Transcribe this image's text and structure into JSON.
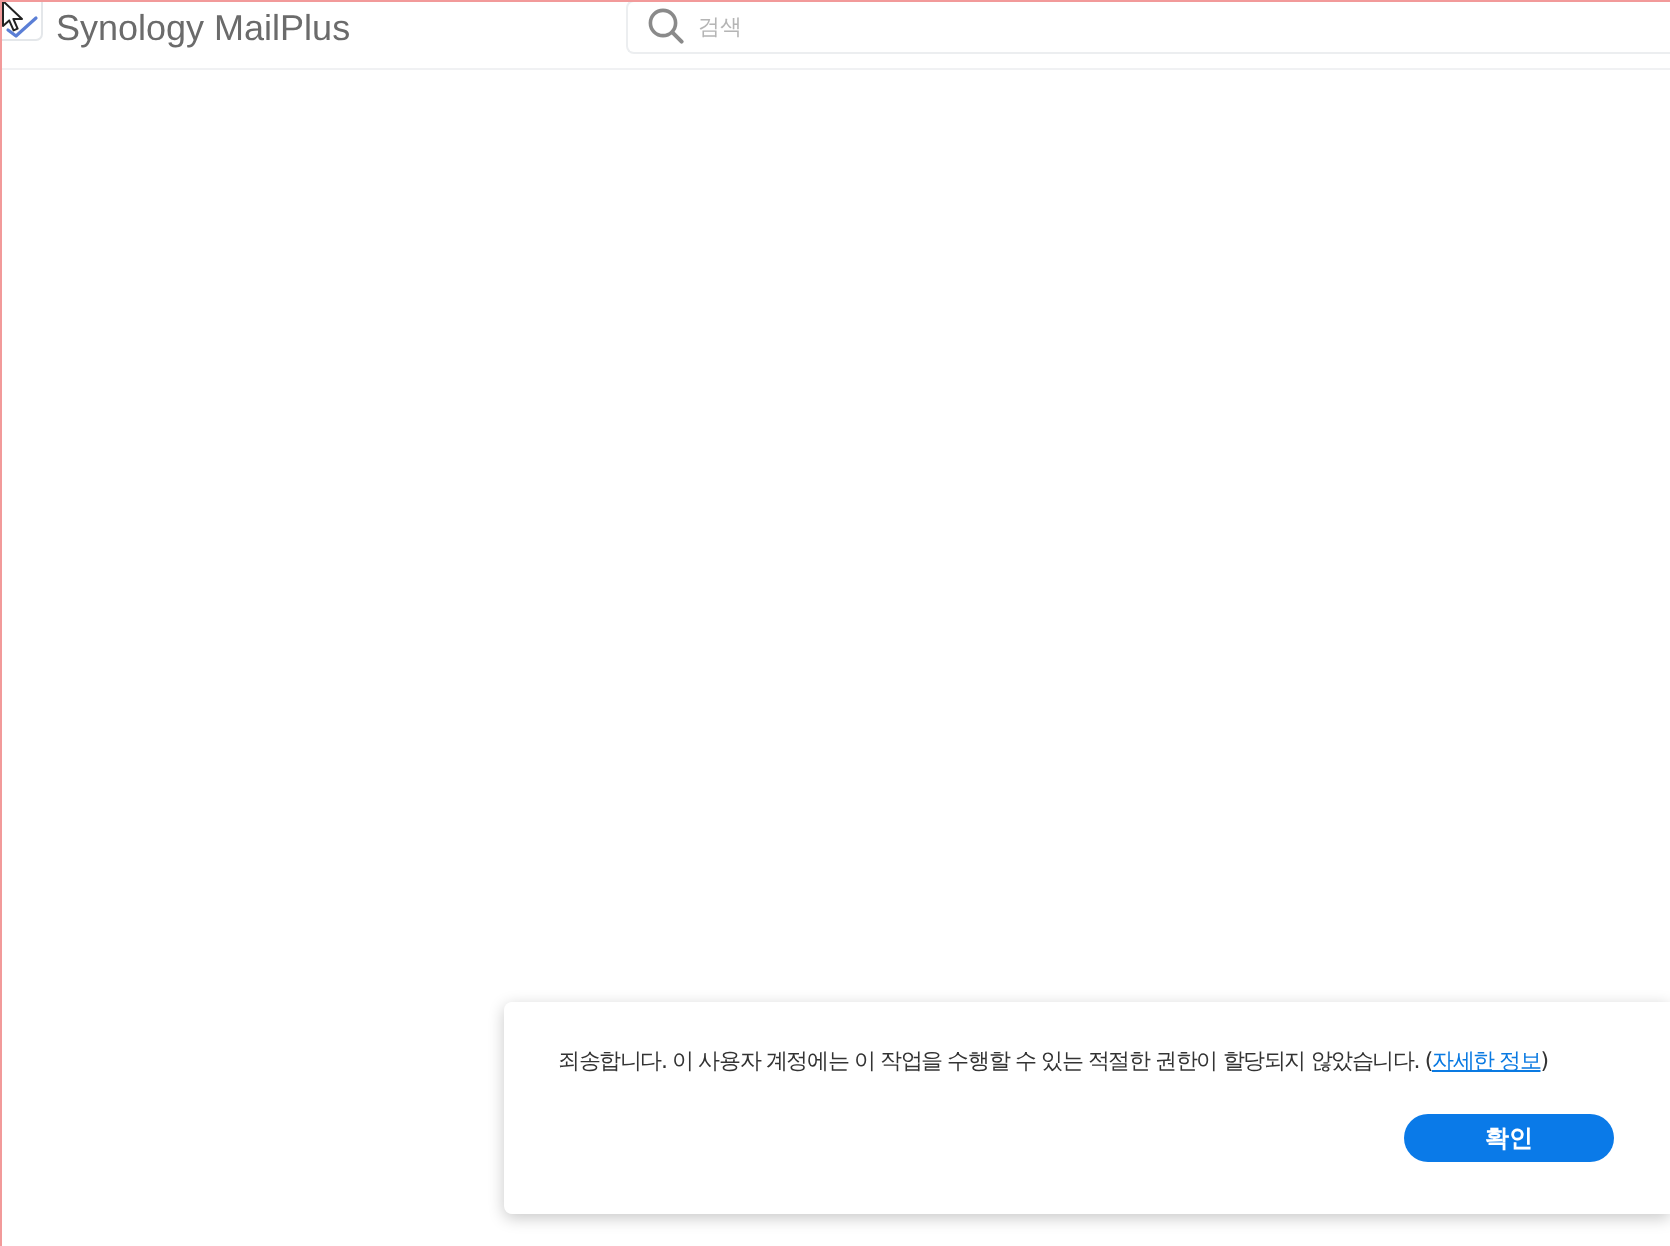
{
  "app": {
    "title": "Synology MailPlus"
  },
  "search": {
    "placeholder": "검색"
  },
  "dialog": {
    "message": "죄송합니다. 이 사용자 계정에는 이 작업을 수행할 수 있는 적절한 권한이 할당되지 않았습니다. (",
    "link": "자세한 정보",
    "message_end": ")",
    "buttons": [
      {
        "label": "확인",
        "kind": "primary"
      }
    ]
  }
}
